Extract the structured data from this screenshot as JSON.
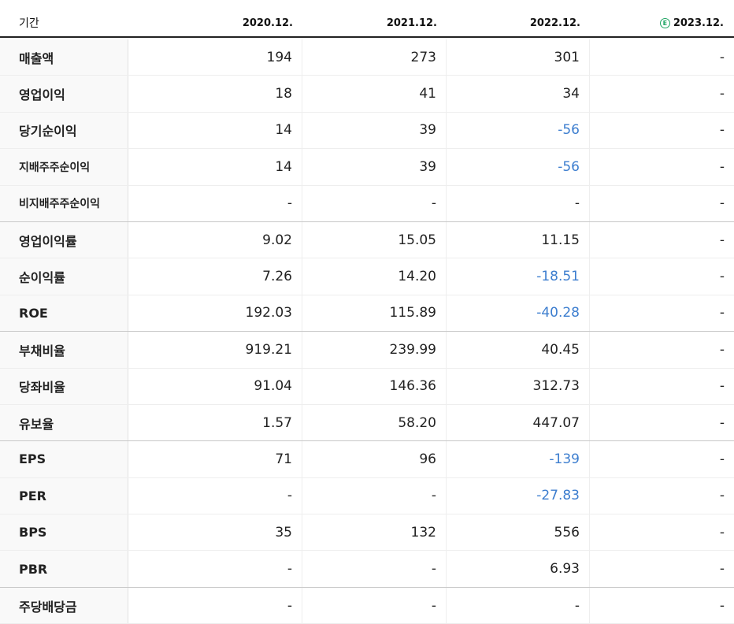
{
  "header": {
    "label": "기간",
    "periods": [
      "2020.12.",
      "2021.12.",
      "2022.12.",
      "2023.12."
    ],
    "estimate_badge": "E"
  },
  "rows": [
    {
      "label": "매출액",
      "values": [
        "194",
        "273",
        "301",
        "-"
      ]
    },
    {
      "label": "영업이익",
      "values": [
        "18",
        "41",
        "34",
        "-"
      ]
    },
    {
      "label": "당기순이익",
      "values": [
        "14",
        "39",
        "-56",
        "-"
      ]
    },
    {
      "label": "지배주주순이익",
      "values": [
        "14",
        "39",
        "-56",
        "-"
      ]
    },
    {
      "label": "비지배주주순이익",
      "values": [
        "-",
        "-",
        "-",
        "-"
      ]
    },
    {
      "label": "영업이익률",
      "values": [
        "9.02",
        "15.05",
        "11.15",
        "-"
      ]
    },
    {
      "label": "순이익률",
      "values": [
        "7.26",
        "14.20",
        "-18.51",
        "-"
      ]
    },
    {
      "label": "ROE",
      "values": [
        "192.03",
        "115.89",
        "-40.28",
        "-"
      ]
    },
    {
      "label": "부채비율",
      "values": [
        "919.21",
        "239.99",
        "40.45",
        "-"
      ]
    },
    {
      "label": "당좌비율",
      "values": [
        "91.04",
        "146.36",
        "312.73",
        "-"
      ]
    },
    {
      "label": "유보율",
      "values": [
        "1.57",
        "58.20",
        "447.07",
        "-"
      ]
    },
    {
      "label": "EPS",
      "values": [
        "71",
        "96",
        "-139",
        "-"
      ]
    },
    {
      "label": "PER",
      "values": [
        "-",
        "-",
        "-27.83",
        "-"
      ]
    },
    {
      "label": "BPS",
      "values": [
        "35",
        "132",
        "556",
        "-"
      ]
    },
    {
      "label": "PBR",
      "values": [
        "-",
        "-",
        "6.93",
        "-"
      ]
    },
    {
      "label": "주당배당금",
      "values": [
        "-",
        "-",
        "-",
        "-"
      ]
    }
  ],
  "colors": {
    "negative": "#3d7ecf",
    "estimate_badge": "#1fa463"
  }
}
